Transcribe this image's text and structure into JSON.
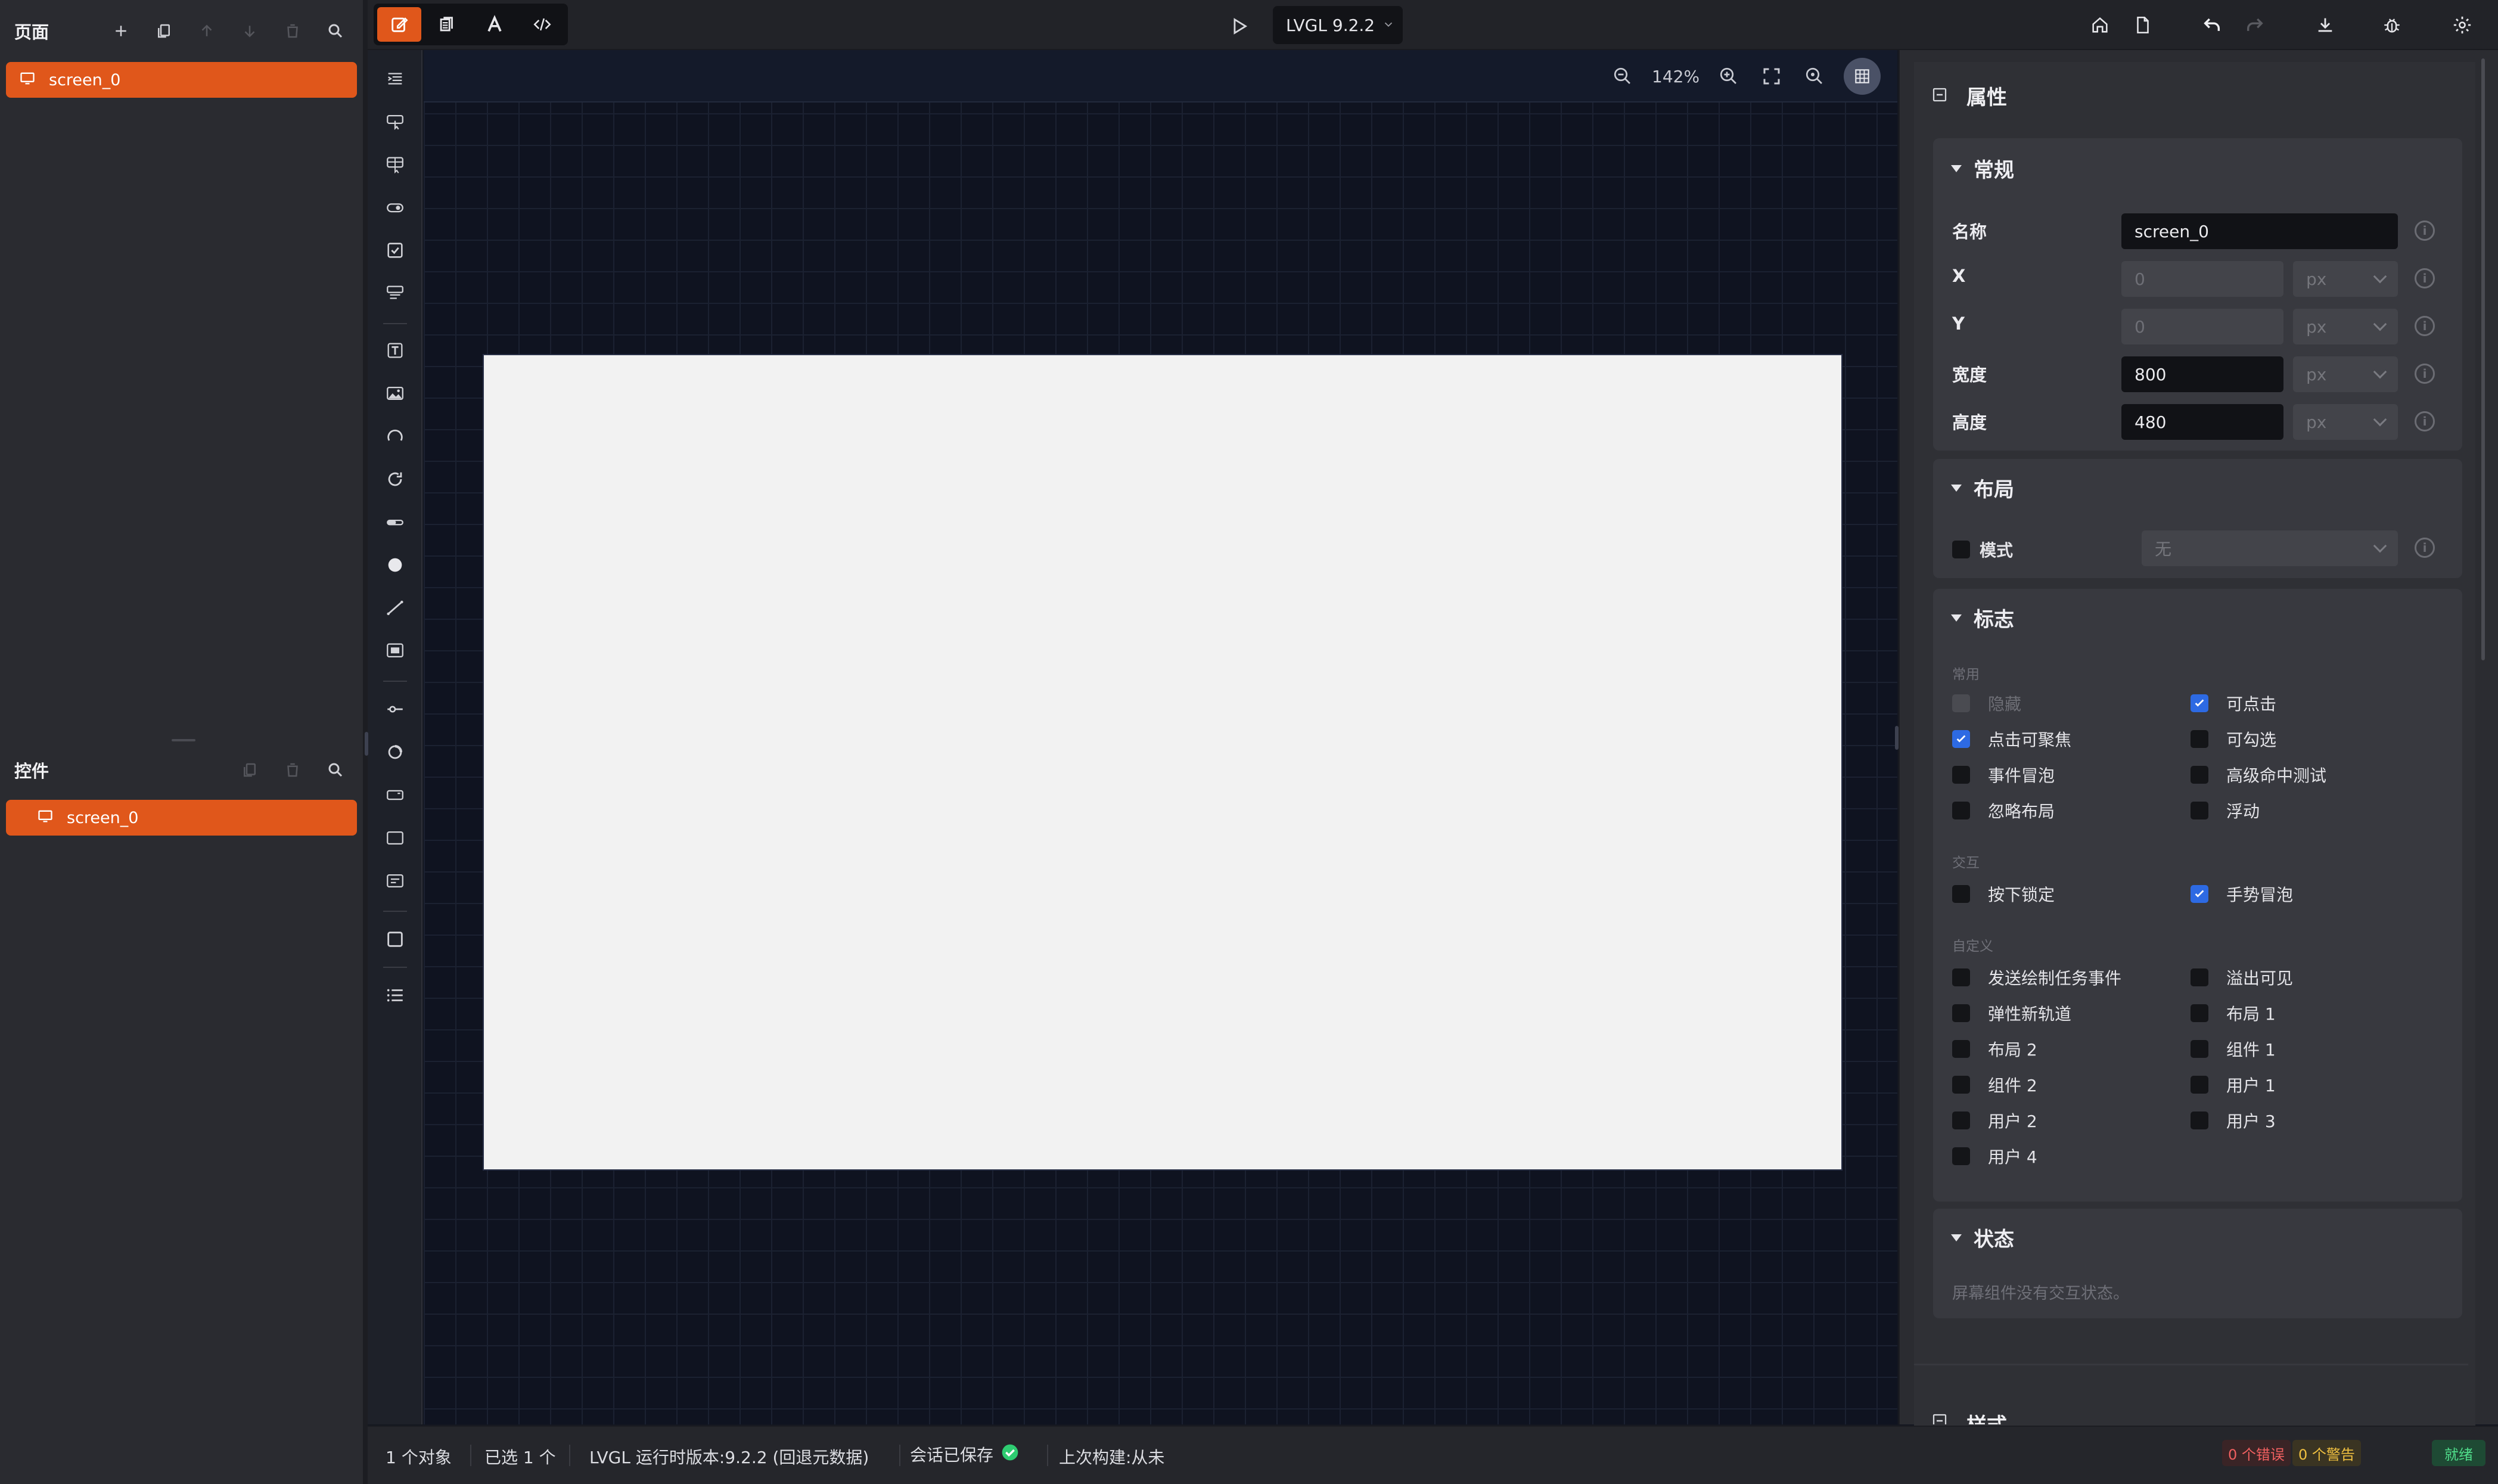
{
  "pages_panel": {
    "title": "页面",
    "items": [
      {
        "label": "screen_0"
      }
    ]
  },
  "widgets_panel": {
    "title": "控件",
    "items": [
      {
        "label": "screen_0"
      }
    ]
  },
  "topbar": {
    "version_label": "LVGL 9.2.2"
  },
  "canvas": {
    "zoom_label": "142%"
  },
  "properties": {
    "title": "属性",
    "general": {
      "title": "常规",
      "name_label": "名称",
      "name_value": "screen_0",
      "x_label": "X",
      "x_value": "0",
      "x_unit": "px",
      "y_label": "Y",
      "y_value": "0",
      "y_unit": "px",
      "width_label": "宽度",
      "width_value": "800",
      "width_unit": "px",
      "height_label": "高度",
      "height_value": "480",
      "height_unit": "px",
      "info_glyph": "i"
    },
    "layout": {
      "title": "布局",
      "mode_label": "模式",
      "mode_value": "无"
    },
    "flags": {
      "title": "标志",
      "common_group": "常用",
      "hidden": "隐藏",
      "clickable": "可点击",
      "click_focusable": "点击可聚焦",
      "checkable": "可勾选",
      "event_bubble": "事件冒泡",
      "adv_hittest": "高级命中测试",
      "ignore_layout": "忽略布局",
      "floating": "浮动",
      "interaction_group": "交互",
      "press_lock": "按下锁定",
      "gesture_bubble": "手势冒泡",
      "custom_group": "自定义",
      "send_draw_task": "发送绘制任务事件",
      "overflow_visible": "溢出可见",
      "flex_in_new_track": "弹性新轨道",
      "layout_1": "布局 1",
      "layout_2": "布局 2",
      "widget_1": "组件 1",
      "widget_2": "组件 2",
      "user_1": "用户 1",
      "user_2": "用户 2",
      "user_3": "用户 3",
      "user_4": "用户 4"
    },
    "states": {
      "title": "状态",
      "empty_text": "屏幕组件没有交互状态。"
    },
    "style_title": "样式"
  },
  "status_bar": {
    "objects": "1 个对象",
    "selected": "已选 1 个",
    "runtime": "LVGL 运行时版本:9.2.2 (回退元数据)",
    "session": "会话已保存",
    "last_build": "上次构建:从未",
    "errors": "0 个错误",
    "warnings": "0 个警告",
    "ready": "就绪"
  },
  "colors": {
    "accent": "#e0571b",
    "checkbox_on": "#2d6ae3",
    "ok": "#2ecc71"
  }
}
